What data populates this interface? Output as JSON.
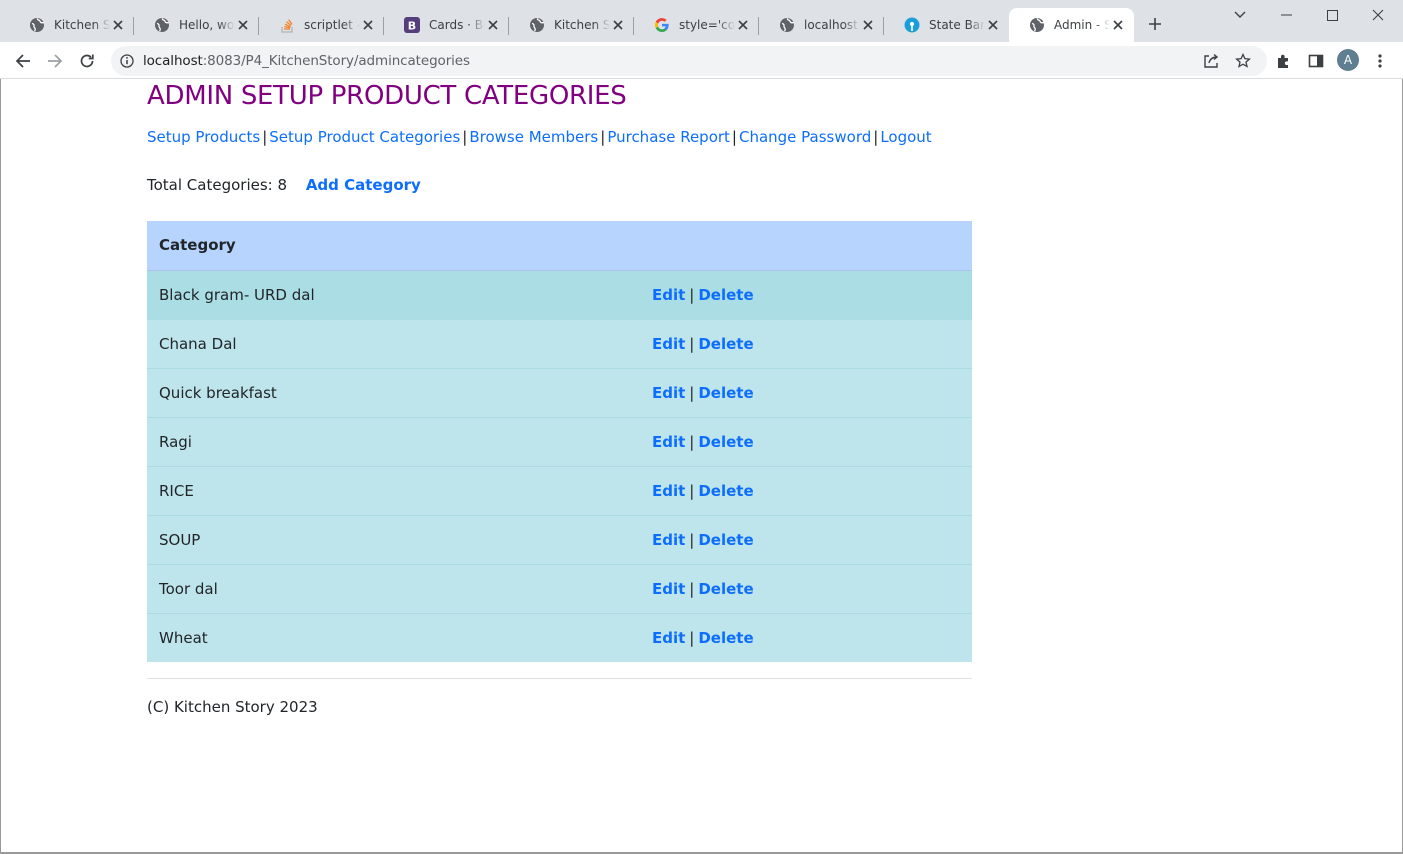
{
  "browser": {
    "tabs": [
      {
        "title": "Kitchen Story",
        "favicon": "globe-icon",
        "active": false
      },
      {
        "title": "Hello, world!",
        "favicon": "globe-icon",
        "active": false
      },
      {
        "title": "scriptlet - How",
        "favicon": "stackoverflow-icon",
        "active": false
      },
      {
        "title": "Cards · Bootstrap",
        "favicon": "bootstrap-icon",
        "active": false
      },
      {
        "title": "Kitchen Story",
        "favicon": "globe-icon",
        "active": false
      },
      {
        "title": "style='color",
        "favicon": "google-icon",
        "active": false
      },
      {
        "title": "localhost",
        "favicon": "globe-icon",
        "active": false
      },
      {
        "title": "State Bank",
        "favicon": "sbi-icon",
        "active": false
      },
      {
        "title": "Admin - Setup",
        "favicon": "globe-icon",
        "active": true
      }
    ],
    "address_bar": {
      "url_host": "localhost",
      "url_rest": ":8083/P4_KitchenStory/admincategories"
    },
    "avatar_letter": "A"
  },
  "page": {
    "title": "ADMIN SETUP PRODUCT CATEGORIES",
    "nav": [
      {
        "label": "Setup Products"
      },
      {
        "label": "Setup Product Categories"
      },
      {
        "label": "Browse Members"
      },
      {
        "label": "Purchase Report"
      },
      {
        "label": "Change Password"
      },
      {
        "label": "Logout"
      }
    ],
    "nav_separator": "|",
    "summary": {
      "total_label": "Total Categories: 8",
      "add_label": "Add Category"
    },
    "table": {
      "header": "Category",
      "edit_label": "Edit",
      "delete_label": "Delete",
      "action_separator": "|",
      "rows": [
        {
          "name": "Black gram- URD dal"
        },
        {
          "name": "Chana Dal"
        },
        {
          "name": "Quick breakfast"
        },
        {
          "name": "Ragi"
        },
        {
          "name": "RICE"
        },
        {
          "name": "SOUP"
        },
        {
          "name": "Toor dal"
        },
        {
          "name": "Wheat"
        }
      ]
    },
    "footer": "(C) Kitchen Story 2023"
  },
  "colors": {
    "title": "#800080",
    "link": "#0d6efd",
    "table_header": "#b6d4fe",
    "table_row": "#bee5eb",
    "table_row_hover": "#abdde5"
  }
}
